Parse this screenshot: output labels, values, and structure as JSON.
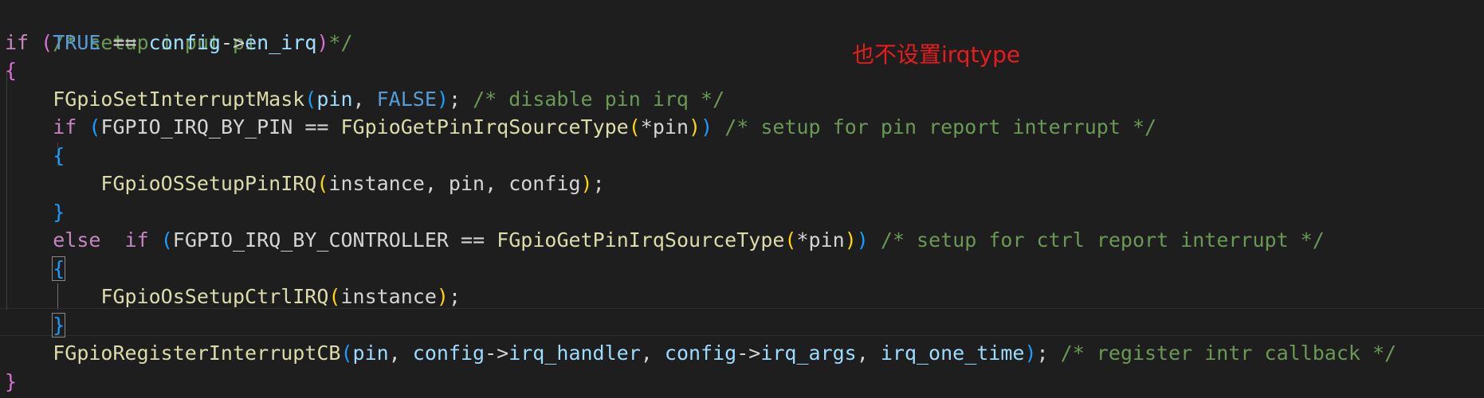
{
  "annotation": "也不设置irqtype",
  "code": {
    "l1": {
      "comment": "/* setup input-pin irq */"
    },
    "l2": {
      "if": "if",
      "open": "(",
      "true": "TRUE",
      "eq": " == ",
      "config": "config",
      "arrow": "->",
      "field": "en_irq",
      "close": ")"
    },
    "l3": {
      "brace": "{"
    },
    "l4": {
      "fn": "FGpioSetInterruptMask",
      "open": "(",
      "arg1": "pin",
      "comma": ", ",
      "false": "FALSE",
      "close": ")",
      "semi": "; ",
      "comment": "/* disable pin irq */"
    },
    "l5": {
      "if": "if",
      "open": "(",
      "const": "FGPIO_IRQ_BY_PIN",
      "eq": " == ",
      "fn": "FGpioGetPinIrqSourceType",
      "open2": "(",
      "arg": "*pin",
      "close2": ")",
      "close": ")",
      "comment": "/* setup for pin report interrupt */"
    },
    "l6": {
      "brace": "{"
    },
    "l7": {
      "fn": "FGpioOSSetupPinIRQ",
      "open": "(",
      "args": "instance, pin, config",
      "close": ")",
      "semi": ";"
    },
    "l8": {
      "brace": "}"
    },
    "l9": {
      "else": "else",
      "if": "if",
      "open": "(",
      "const": "FGPIO_IRQ_BY_CONTROLLER",
      "eq": " == ",
      "fn": "FGpioGetPinIrqSourceType",
      "open2": "(",
      "arg": "*pin",
      "close2": ")",
      "close": ")",
      "comment": "/* setup for ctrl report interrupt */"
    },
    "l10": {
      "brace": "{"
    },
    "l11": {
      "fn": "FGpioOsSetupCtrlIRQ",
      "open": "(",
      "args": "instance",
      "close": ")",
      "semi": ";"
    },
    "l12": {
      "brace": "}"
    },
    "l13": {
      "fn": "FGpioRegisterInterruptCB",
      "open": "(",
      "arg1": "pin",
      "comma1": ", ",
      "cfg1": "config",
      "arrow1": "->",
      "field1": "irq_handler",
      "comma2": ", ",
      "cfg2": "config",
      "arrow2": "->",
      "field2": "irq_args",
      "comma3": ", ",
      "arg4": "irq_one_time",
      "close": ")",
      "semi": "; ",
      "comment": "/* register intr callback */"
    },
    "l14": {
      "brace": "}"
    }
  },
  "colors": {
    "background": "#1e1e1e",
    "comment": "#6a9955",
    "control_keyword": "#c586c0",
    "keyword": "#569cd6",
    "function": "#dcdcaa",
    "variable": "#9cdcfe",
    "annotation": "#e81c1c"
  }
}
